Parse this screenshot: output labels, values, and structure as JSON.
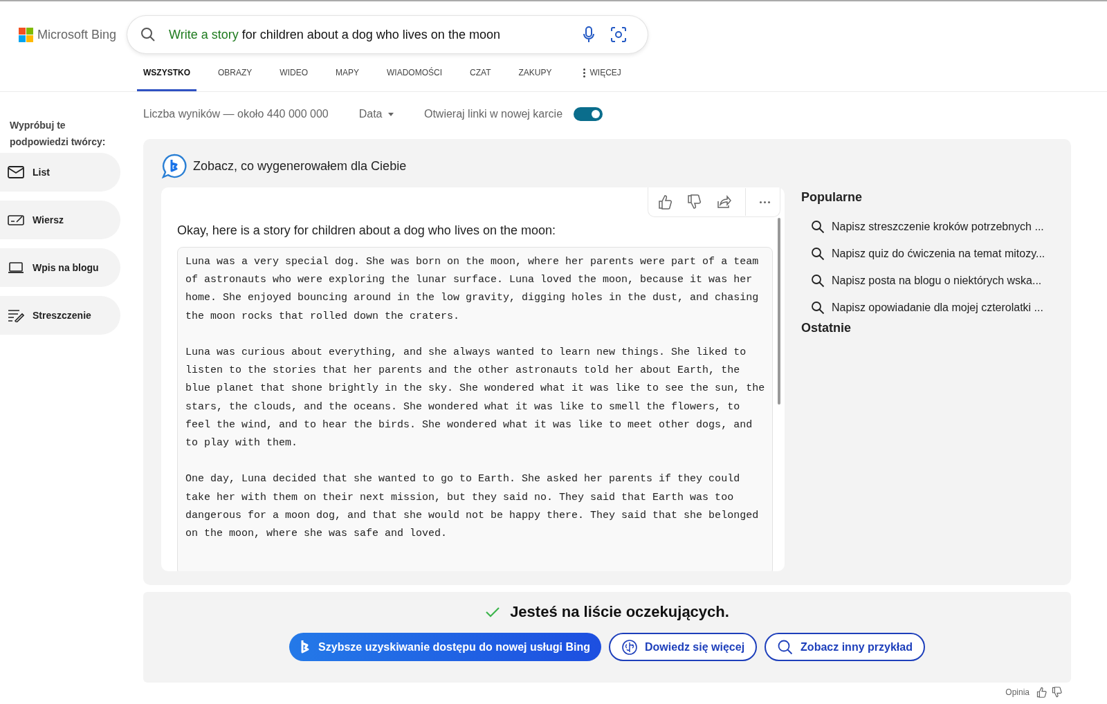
{
  "logo": {
    "text": "Microsoft Bing"
  },
  "search": {
    "highlight": "Write a story",
    "value": "for children about a dog who lives on the moon"
  },
  "tabs": [
    {
      "label": "WSZYSTKO",
      "selected": true
    },
    {
      "label": "OBRAZY",
      "selected": false
    },
    {
      "label": "WIDEO",
      "selected": false
    },
    {
      "label": "MAPY",
      "selected": false
    },
    {
      "label": "WIADOMOŚCI",
      "selected": false
    },
    {
      "label": "CZAT",
      "selected": false
    },
    {
      "label": "ZAKUPY",
      "selected": false
    },
    {
      "label": "WIĘCEJ",
      "selected": false
    }
  ],
  "toolbar": {
    "results": "Liczba wyników — około 440 000 000",
    "date": "Data",
    "new_tab_label": "Otwieraj linki w nowej karcie",
    "new_tab_on": true
  },
  "sidebar": {
    "title": "Wypróbuj te podpowiedzi twórcy:",
    "items": [
      {
        "label": "List",
        "kind": "mail"
      },
      {
        "label": "Wiersz",
        "kind": "poem"
      },
      {
        "label": "Wpis na blogu",
        "kind": "laptop"
      },
      {
        "label": "Streszczenie",
        "kind": "summary"
      }
    ]
  },
  "answer": {
    "heading": "Zobacz, co wygenerowałem dla Ciebie",
    "intro": "Okay, here is a story for children about a dog who lives on the moon:",
    "paragraphs": [
      "Luna was a very special dog. She was born on the moon, where her parents were part of a team of astronauts who were exploring the lunar surface. Luna loved the moon, because it was her home. She enjoyed bouncing around in the low gravity, digging holes in the dust, and chasing the moon rocks that rolled down the craters.",
      "Luna was curious about everything, and she always wanted to learn new things. She liked to listen to the stories that her parents and the other astronauts told her about Earth, the blue planet that shone brightly in the sky. She wondered what it was like to see the sun, the stars, the clouds, and the oceans. She wondered what it was like to smell the flowers, to feel the wind, and to hear the birds. She wondered what it was like to meet other dogs, and to play with them.",
      "One day, Luna decided that she wanted to go to Earth. She asked her parents if they could take her with them on their next mission, but they said no. They said that Earth was too dangerous for a moon dog, and that she would not be happy there. They said that she belonged on the moon, where she was safe and loved."
    ]
  },
  "popular": {
    "title": "Popularne",
    "items": [
      "Napisz streszczenie kroków potrzebnych ...",
      "Napisz quiz do ćwiczenia na temat mitozy...",
      "Napisz posta na blogu o niektórych wska...",
      "Napisz opowiadanie dla mojej czterolatki ..."
    ]
  },
  "recent": {
    "title": "Ostatnie"
  },
  "waitlist": {
    "message": "Jesteś na liście oczekujących.",
    "buttons": [
      {
        "label": "Szybsze uzyskiwanie dostępu do nowej usługi Bing",
        "kind": "primary"
      },
      {
        "label": "Dowiedz się więcej",
        "kind": "learn"
      },
      {
        "label": "Zobacz inny przykład",
        "kind": "search"
      }
    ]
  },
  "feedback": {
    "label": "Opinia"
  }
}
